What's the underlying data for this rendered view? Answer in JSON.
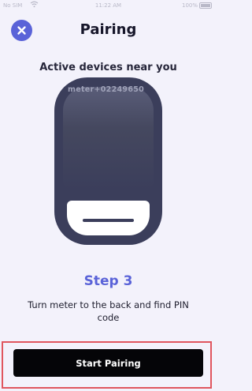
{
  "status_bar": {
    "carrier": "No SIM",
    "time": "11:22 AM",
    "battery": "100%"
  },
  "header": {
    "title": "Pairing",
    "close_icon": "close-icon"
  },
  "devices": {
    "title": "Active devices near you",
    "meter_id": "meter+02249650"
  },
  "step": {
    "title": "Step 3",
    "description": "Turn meter to the back and find PIN code"
  },
  "footer": {
    "button_label": "Start Pairing"
  },
  "colors": {
    "accent": "#5a63d8",
    "background": "#f3f2fb",
    "device": "#3b3e5b",
    "button": "#050508",
    "highlight": "#e0565e"
  }
}
